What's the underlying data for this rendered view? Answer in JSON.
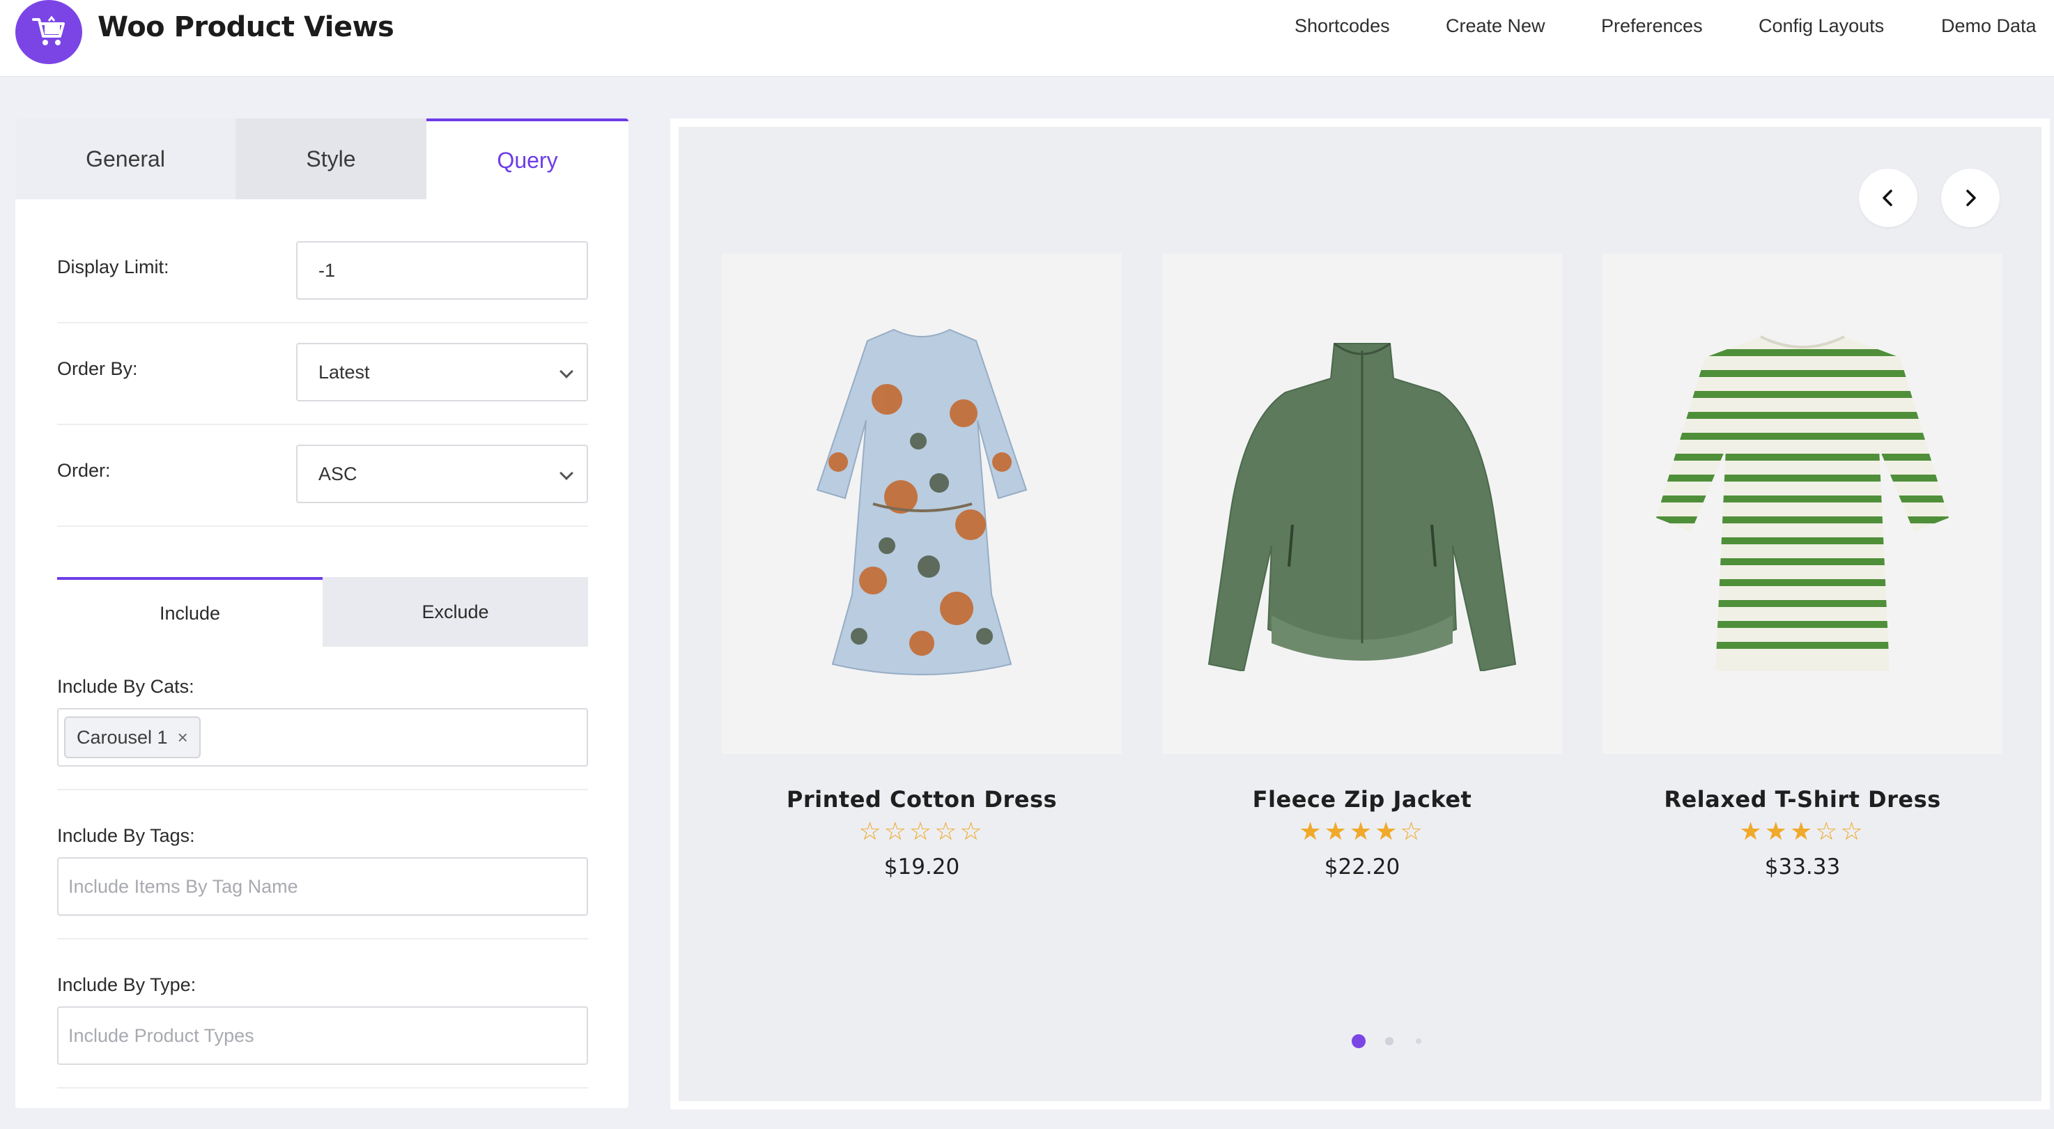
{
  "header": {
    "app_title": "Woo Product Views",
    "logo_icon": "shopping-cart-icon",
    "accent_color": "#7b45e6",
    "nav": [
      "Shortcodes",
      "Create New",
      "Preferences",
      "Config Layouts",
      "Demo Data"
    ]
  },
  "left_panel": {
    "tabs": [
      "General",
      "Style",
      "Query"
    ],
    "active_tab": "Query",
    "display_limit": {
      "label": "Display Limit:",
      "value": "-1"
    },
    "order_by": {
      "label": "Order By:",
      "value": "Latest"
    },
    "order": {
      "label": "Order:",
      "value": "ASC"
    },
    "subtabs": [
      "Include",
      "Exclude"
    ],
    "active_subtab": "Include",
    "include_cats": {
      "label": "Include By Cats:",
      "chips": [
        "Carousel 1"
      ],
      "chip_remove": "×"
    },
    "include_tags": {
      "label": "Include By Tags:",
      "placeholder": "Include Items By Tag Name"
    },
    "include_type": {
      "label": "Include By Type:",
      "placeholder": "Include Product Types"
    }
  },
  "carousel": {
    "prev_icon": "chevron-left-icon",
    "next_icon": "chevron-right-icon",
    "products": [
      {
        "title": "Printed Cotton Dress",
        "rating": 0,
        "stars": "☆☆☆☆☆",
        "price": "$19.20",
        "image": "floral-dress"
      },
      {
        "title": "Fleece Zip Jacket",
        "rating": 4,
        "stars": "★★★★☆",
        "price": "$22.20",
        "image": "green-fleece-jacket"
      },
      {
        "title": "Relaxed T-Shirt Dress",
        "rating": 3,
        "stars": "★★★☆☆",
        "price": "$33.33",
        "image": "striped-tshirt-dress"
      }
    ],
    "pagination": {
      "total": 3,
      "active": 1
    }
  }
}
